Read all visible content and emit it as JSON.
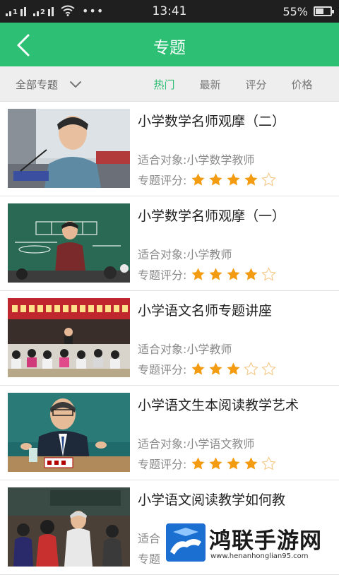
{
  "status_bar": {
    "sim1_label": "1",
    "sim2_label": "2",
    "time": "13:41",
    "battery_percent": "55%",
    "battery_level": 0.55
  },
  "header": {
    "title": "专题",
    "back_icon": "chevron-left-icon"
  },
  "filter_bar": {
    "category_label": "全部专题",
    "tabs": [
      {
        "label": "热门",
        "active": true
      },
      {
        "label": "最新",
        "active": false
      },
      {
        "label": "评分",
        "active": false
      },
      {
        "label": "价格",
        "active": false
      }
    ]
  },
  "topics": [
    {
      "title": "小学数学名师观摩（二）",
      "target": "适合对象:小学数学教师",
      "rating_label": "专题评分:",
      "stars": 4
    },
    {
      "title": "小学数学名师观摩（一）",
      "target": "适合对象:小学教师",
      "rating_label": "专题评分:",
      "stars": 4
    },
    {
      "title": "小学语文名师专题讲座",
      "target": "适合对象:小学教师",
      "rating_label": "专题评分:",
      "stars": 3
    },
    {
      "title": "小学语文生本阅读教学艺术",
      "target": "适合对象:小学语文教师",
      "rating_label": "专题评分:",
      "stars": 4
    },
    {
      "title": "小学语文阅读教学如何教",
      "target": "适合",
      "rating_label": "专题",
      "stars": 0
    }
  ],
  "colors": {
    "accent": "#2dbf73",
    "star": "#f39c12"
  },
  "watermark": {
    "title": "鸿联手游网",
    "url": "www.henanhonglian95.com"
  }
}
